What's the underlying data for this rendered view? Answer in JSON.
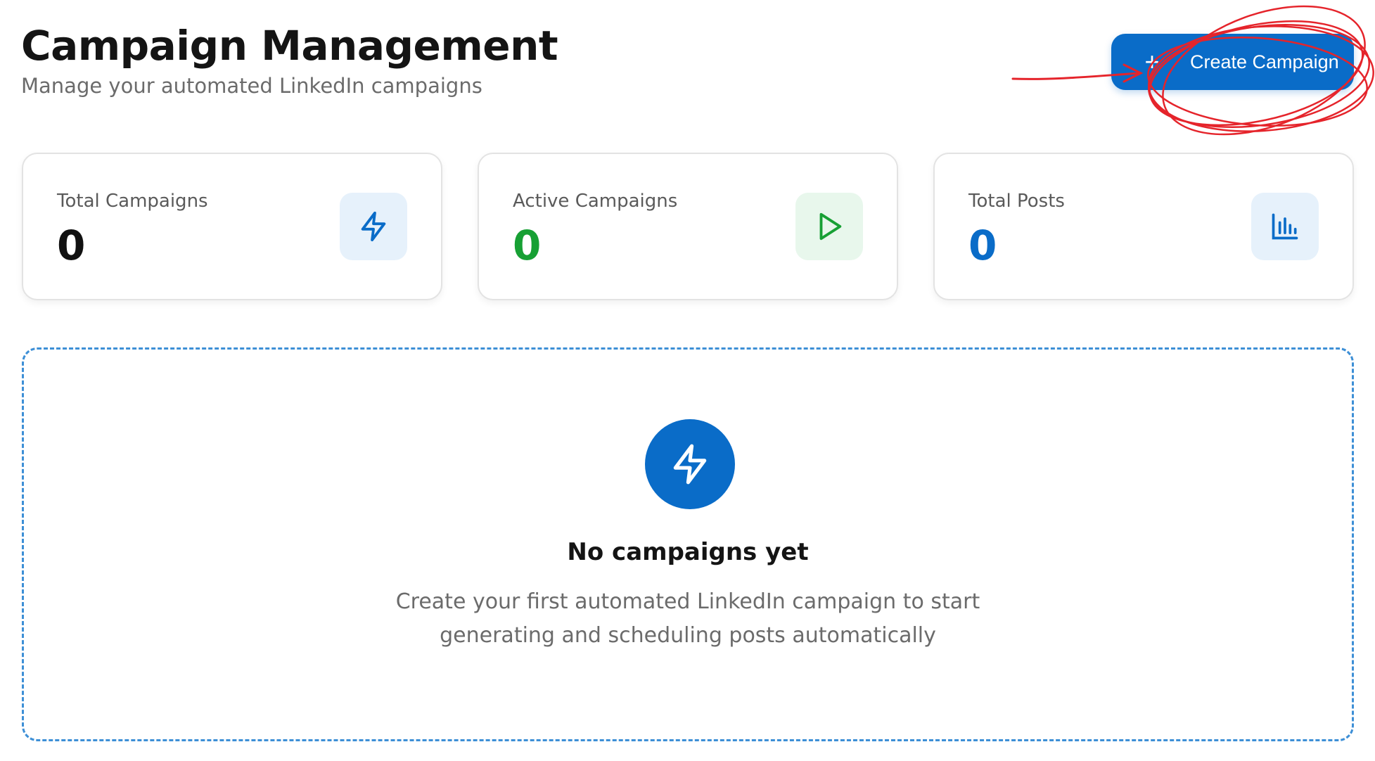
{
  "header": {
    "title": "Campaign Management",
    "subtitle": "Manage your automated LinkedIn campaigns"
  },
  "actions": {
    "create_label": "Create Campaign",
    "create_icon": "plus-icon"
  },
  "stats": [
    {
      "label": "Total Campaigns",
      "value": "0",
      "value_color": "#111111",
      "icon": "lightning-icon",
      "icon_color": "#0a6cc8",
      "icon_bg": "#e6f1fb"
    },
    {
      "label": "Active Campaigns",
      "value": "0",
      "value_color": "#17a034",
      "icon": "play-icon",
      "icon_color": "#17a034",
      "icon_bg": "#e8f7ec"
    },
    {
      "label": "Total Posts",
      "value": "0",
      "value_color": "#0a6cc8",
      "icon": "bar-chart-icon",
      "icon_color": "#0a6cc8",
      "icon_bg": "#e6f1fb"
    }
  ],
  "empty_state": {
    "icon": "lightning-icon",
    "title": "No campaigns yet",
    "description_line1": "Create your first automated LinkedIn campaign to start",
    "description_line2": "generating and scheduling posts automatically"
  },
  "colors": {
    "primary": "#0a6cc8",
    "success": "#17a034",
    "annotation": "#e5242b"
  }
}
